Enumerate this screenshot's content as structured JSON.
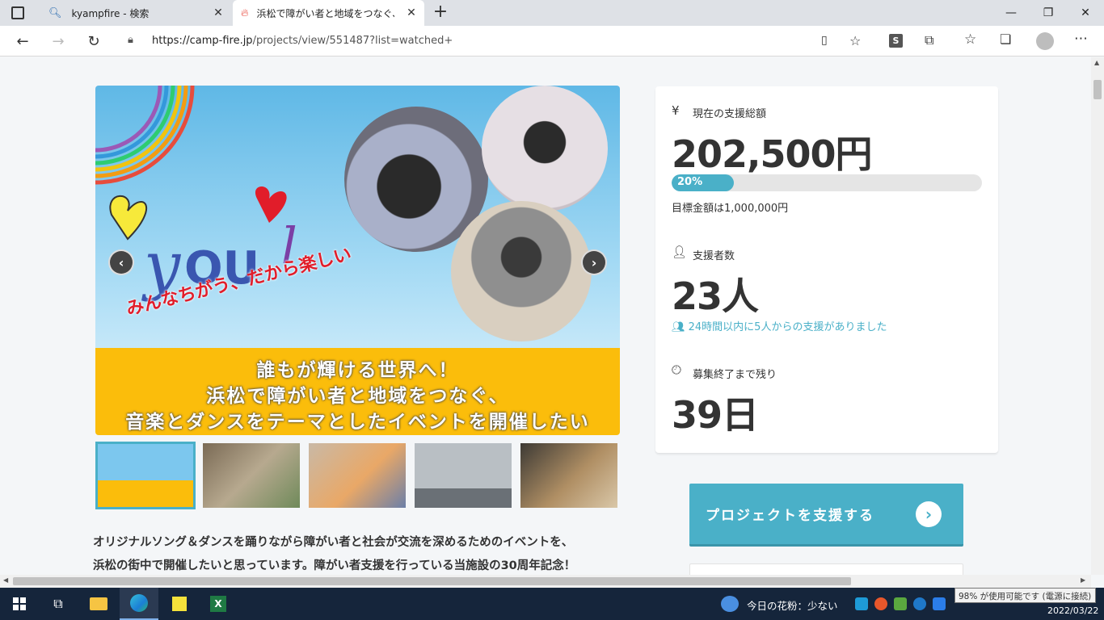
{
  "browser": {
    "tabs": [
      {
        "title": "kyampfire - 検索",
        "icon": "search-icon"
      },
      {
        "title": "浜松で障がい者と地域をつなぐ、音楽",
        "icon": "campfire-flame-icon"
      }
    ],
    "url_host": "https://camp-fire.jp",
    "url_path": "/projects/view/551487?list=watched+"
  },
  "hero": {
    "slogan": "みんなちがう、だから楽しい",
    "banner_lines": [
      "誰もが輝ける世界へ！",
      "浜松で障がい者と地域をつなぐ、",
      "音楽とダンスをテーマとしたイベントを開催したい"
    ]
  },
  "description": {
    "lines": [
      "オリジナルソング＆ダンスを踊りながら障がい者と社会が交流を深めるためのイベントを、",
      "浜松の街中で開催したいと思っています。障がい者支援を行っている当施設の30周年記念！"
    ]
  },
  "stats": {
    "total_label": "現在の支援総額",
    "total_value": "202,500円",
    "progress_percent": 20,
    "progress_label": "20%",
    "goal_text": "目標金額は1,000,000円",
    "backers_label": "支援者数",
    "backers_value": "23人",
    "recent_text": "24時間以内に5人からの支援がありました",
    "remaining_label": "募集終了まで残り",
    "remaining_value": "39日"
  },
  "support_button": {
    "label": "プロジェクトを支援する"
  },
  "taskbar": {
    "pollen": "今日の花粉：少ない",
    "battery_tooltip": "98% が使用可能です (電源に接続)",
    "date": "2022/03/22"
  },
  "colors": {
    "accent": "#4ab0c8",
    "banner": "#fbbd0b",
    "text": "#333333"
  }
}
